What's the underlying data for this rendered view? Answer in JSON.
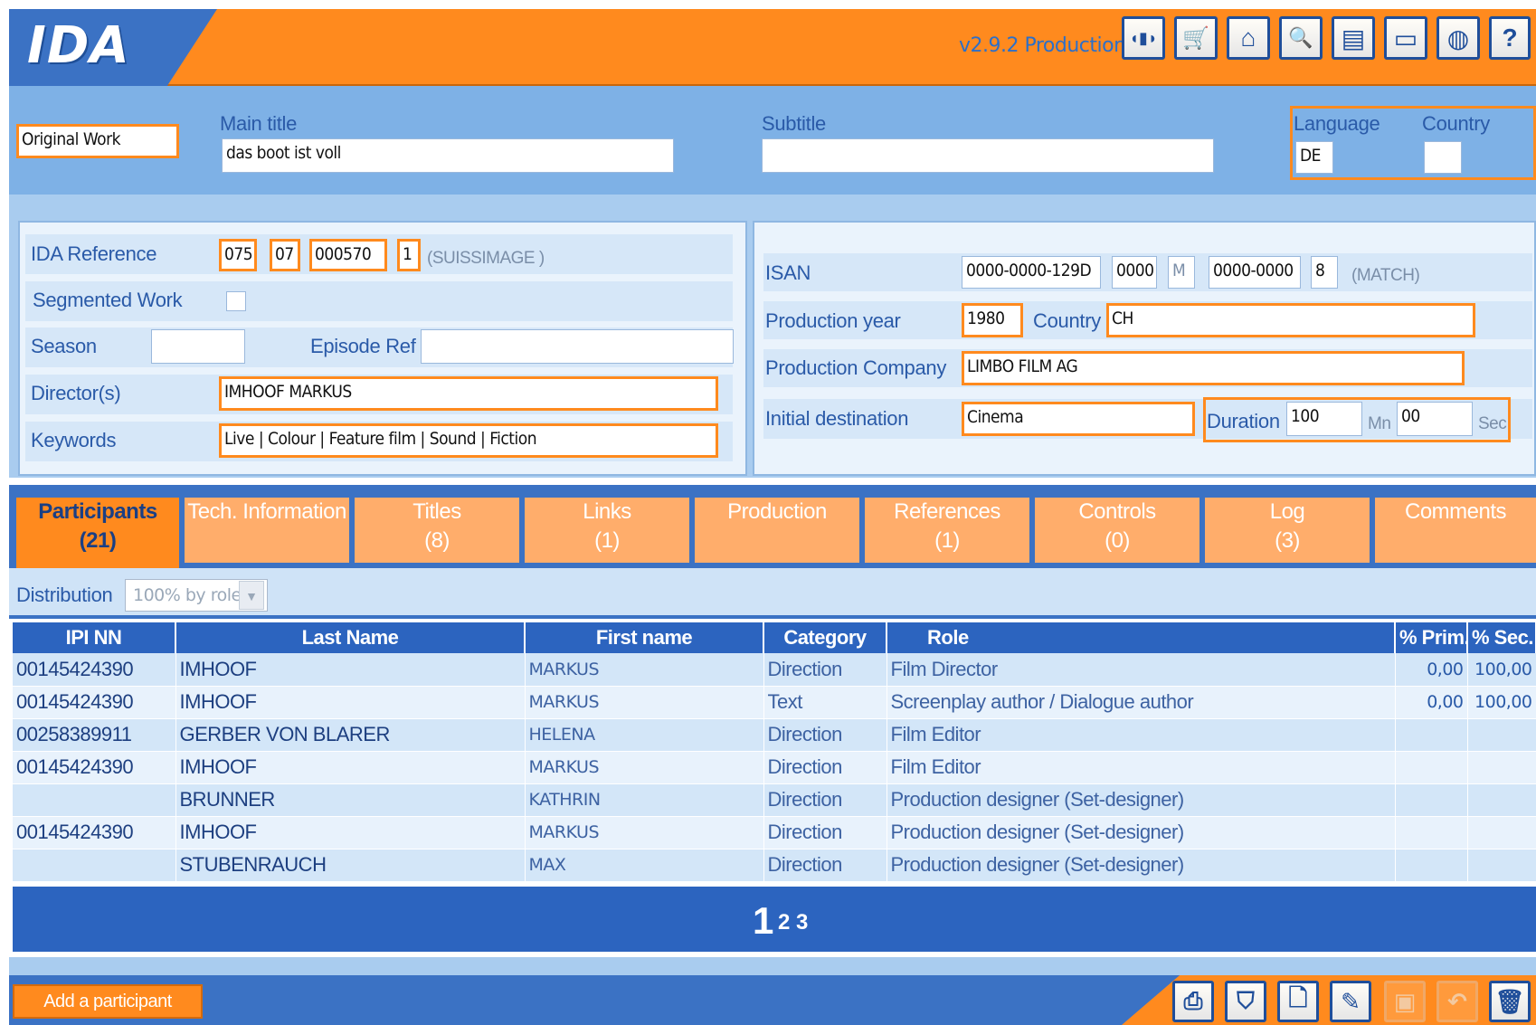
{
  "header": {
    "logo": "IDA",
    "version": "v2.9.2 Production",
    "toolbar_icons": [
      "film-icon",
      "cart-icon",
      "home-icon",
      "search-document-icon",
      "document-icon",
      "card-icon",
      "globe-icon",
      "help-icon"
    ],
    "toolbar_glyphs": [
      "◖▮◗",
      "🛒",
      "⌂",
      "🔍",
      "▤",
      "▭",
      "◍",
      "?"
    ]
  },
  "title_section": {
    "work_type": "Original Work",
    "main_title_label": "Main title",
    "main_title_value": "das boot ist voll",
    "subtitle_label": "Subtitle",
    "subtitle_value": "",
    "language_label": "Language",
    "language_value": "DE",
    "country_label": "Country",
    "country_value": ""
  },
  "left_panel": {
    "ida_reference_label": "IDA Reference",
    "ida_ref_1": "075",
    "ida_ref_2": "07",
    "ida_ref_3": "000570",
    "ida_ref_4": "1",
    "ida_ref_society": "(SUISSIMAGE )",
    "segmented_work_label": "Segmented Work",
    "season_label": "Season",
    "season_value": "",
    "episode_ref_label": "Episode Ref",
    "episode_ref_value": "",
    "directors_label": "Director(s)",
    "directors_value": "IMHOOF MARKUS",
    "keywords_label": "Keywords",
    "keywords_value": "Live | Colour | Feature film | Sound | Fiction"
  },
  "right_panel": {
    "isan_label": "ISAN",
    "isan_1": "0000-0000-129D",
    "isan_2": "0000",
    "isan_3": "M",
    "isan_4": "0000-0000",
    "isan_5": "8",
    "isan_status": "(MATCH)",
    "production_year_label": "Production year",
    "production_year_value": "1980",
    "country_label": "Country",
    "country_value": "CH",
    "production_company_label": "Production Company",
    "production_company_value": "LIMBO FILM AG",
    "initial_destination_label": "Initial destination",
    "initial_destination_value": "Cinema",
    "duration_label": "Duration",
    "duration_min": "100",
    "duration_min_unit": "Mn",
    "duration_sec": "00",
    "duration_sec_unit": "Sec"
  },
  "tabs": [
    {
      "label": "Participants",
      "count": "(21)"
    },
    {
      "label": "Tech. Information",
      "count": ""
    },
    {
      "label": "Titles",
      "count": "(8)"
    },
    {
      "label": "Links",
      "count": "(1)"
    },
    {
      "label": "Production",
      "count": ""
    },
    {
      "label": "References",
      "count": "(1)"
    },
    {
      "label": "Controls",
      "count": "(0)"
    },
    {
      "label": "Log",
      "count": "(3)"
    },
    {
      "label": "Comments",
      "count": ""
    }
  ],
  "distribution": {
    "label": "Distribution",
    "selected": "100% by role"
  },
  "table": {
    "headers": [
      "IPI NN",
      "Last Name",
      "First name",
      "Category",
      "Role",
      "% Prim.",
      "% Sec."
    ],
    "rows": [
      [
        "00145424390",
        "IMHOOF",
        "MARKUS",
        "Direction",
        "Film Director",
        "0,00",
        "100,00"
      ],
      [
        "00145424390",
        "IMHOOF",
        "MARKUS",
        "Text",
        "Screenplay author / Dialogue author",
        "0,00",
        "100,00"
      ],
      [
        "00258389911",
        "GERBER VON BLARER",
        "HELENA",
        "Direction",
        "Film Editor",
        "",
        ""
      ],
      [
        "00145424390",
        "IMHOOF",
        "MARKUS",
        "Direction",
        "Film Editor",
        "",
        ""
      ],
      [
        "",
        "BRUNNER",
        "KATHRIN",
        "Direction",
        "Production designer (Set-designer)",
        "",
        ""
      ],
      [
        "00145424390",
        "IMHOOF",
        "MARKUS",
        "Direction",
        "Production designer (Set-designer)",
        "",
        ""
      ],
      [
        "",
        "STUBENRAUCH",
        "MAX",
        "Direction",
        "Production designer (Set-designer)",
        "",
        ""
      ]
    ]
  },
  "pager": {
    "current": "1",
    "page2": "2",
    "page3": "3"
  },
  "footer": {
    "add_button": "Add a participant",
    "action_icons": [
      "print-icon",
      "basket-icon",
      "new-document-icon",
      "edit-pencil-icon",
      "save-icon",
      "undo-icon",
      "trash-icon"
    ],
    "action_glyphs": [
      "⎙",
      "⛉",
      "🗋",
      "✎",
      "▣",
      "↶",
      "🗑"
    ]
  }
}
